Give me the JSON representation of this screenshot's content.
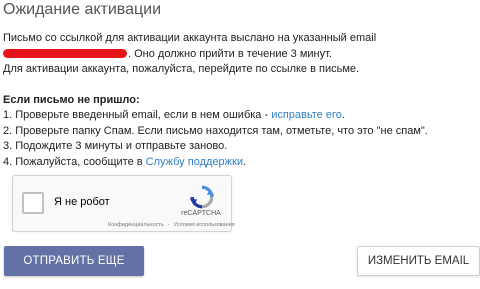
{
  "page": {
    "title": "Ожидание активации"
  },
  "message": {
    "line1": "Письмо со ссылкой для активации аккаунта выслано на указанный email",
    "line2_suffix": ". Оно должно прийти в течение 3 минут.",
    "line3": "Для активации аккаунта, пожалуйста, перейдите по ссылке в письме."
  },
  "help": {
    "heading": "Если письмо не пришло:",
    "item1_text": "1. Проверьте введенный email, если в нем ошибка - ",
    "item1_link": "исправьте его",
    "item1_end": ".",
    "item2": "2. Проверьте папку Спам. Если письмо находится там, отметьте, что это \"не спам\".",
    "item3": "3. Подождите 3 минуты и отправьте заново.",
    "item4_text": "4. Пожалуйста, сообщите в ",
    "item4_link": "Службу поддержки",
    "item4_end": "."
  },
  "captcha": {
    "checkbox_label": "Я не робот",
    "brand": "reCAPTCHA",
    "privacy_link": "Конфиденциальность",
    "separator": "-",
    "terms_link": "Условия использования"
  },
  "buttons": {
    "resend": "ОТПРАВИТЬ ЕЩЕ",
    "change_email": "ИЗМЕНИТЬ EMAIL"
  },
  "colors": {
    "primary_button": "#6471a6",
    "link": "#2f7fc9",
    "redaction": "#e8141b"
  }
}
